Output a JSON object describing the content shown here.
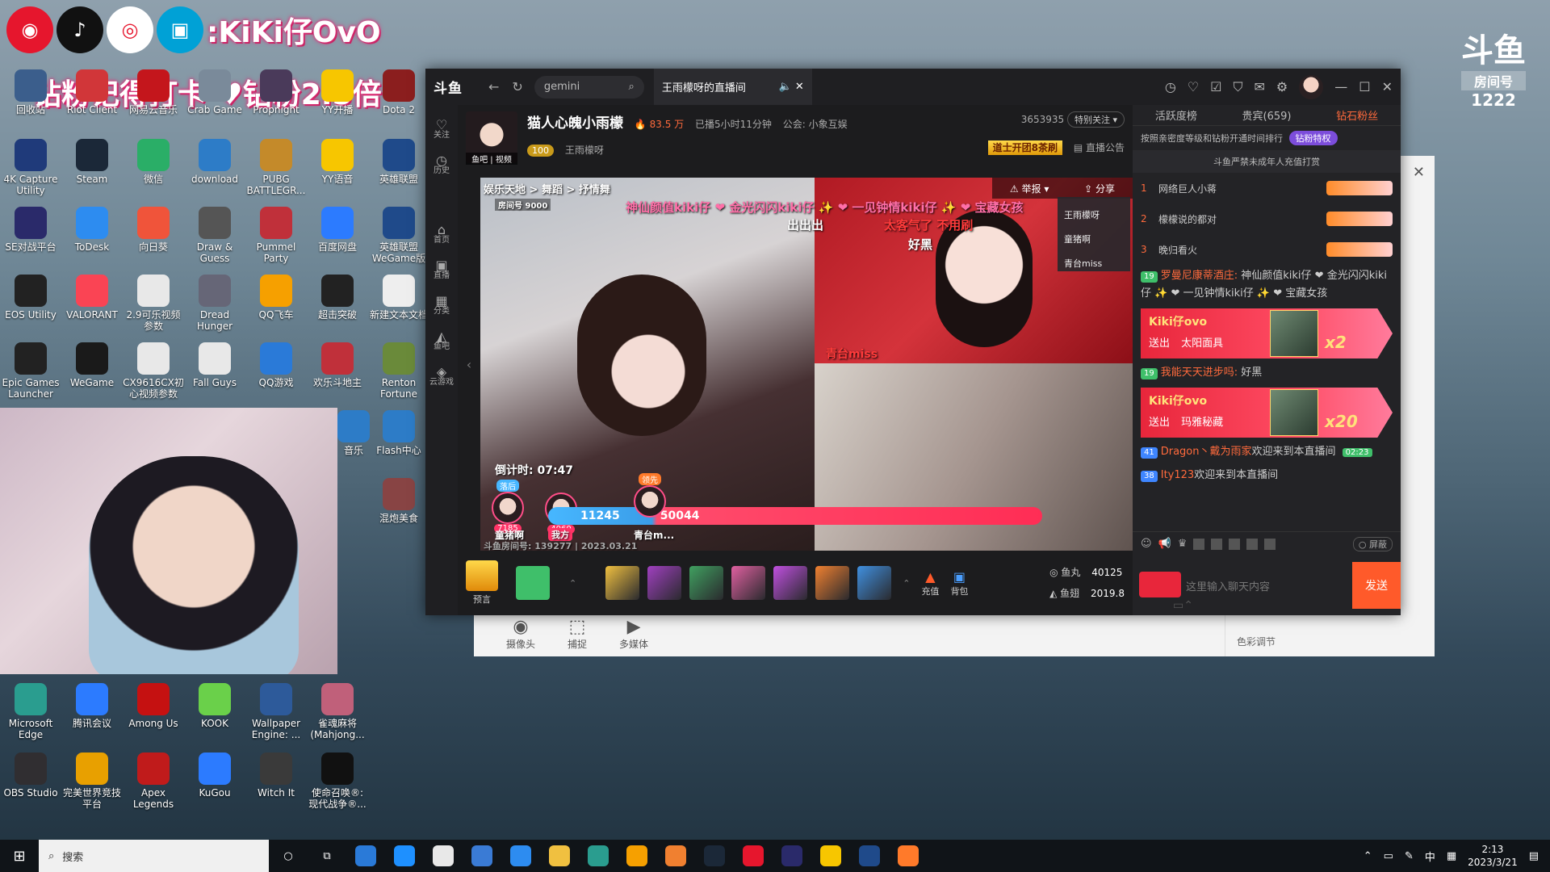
{
  "overlay": {
    "social_tag": ":KiKi仔OvO",
    "banner": "钻粉记得打卡 ♥钻粉2.5倍"
  },
  "brand": {
    "logo": "斗鱼",
    "room_label": "房间号",
    "room_no": "1222"
  },
  "desktop_icons": [
    {
      "label": "回收站",
      "color": "#3b5e8c"
    },
    {
      "label": "Riot Client",
      "color": "#d13639"
    },
    {
      "label": "网易云音乐",
      "color": "#c4161c"
    },
    {
      "label": "Crab Game",
      "color": "#7a8a9a"
    },
    {
      "label": "Propnight",
      "color": "#4a3a5a"
    },
    {
      "label": "YY开播",
      "color": "#f7c600"
    },
    {
      "label": "Dota 2",
      "color": "#8b1e1e"
    },
    {
      "label": "4K Capture Utility",
      "color": "#1f3a7a"
    },
    {
      "label": "Steam",
      "color": "#1b2838"
    },
    {
      "label": "微信",
      "color": "#2aae67"
    },
    {
      "label": "download",
      "color": "#2d7cc7"
    },
    {
      "label": "PUBG BATTLEGR...",
      "color": "#c48a2a"
    },
    {
      "label": "YY语音",
      "color": "#f7c600"
    },
    {
      "label": "英雄联盟",
      "color": "#1f4a8a"
    },
    {
      "label": "SE对战平台",
      "color": "#2a2a6a"
    },
    {
      "label": "ToDesk",
      "color": "#2d8cf0"
    },
    {
      "label": "向日葵",
      "color": "#f0543a"
    },
    {
      "label": "Draw & Guess",
      "color": "#555"
    },
    {
      "label": "Pummel Party",
      "color": "#c0303a"
    },
    {
      "label": "百度网盘",
      "color": "#2c7bff"
    },
    {
      "label": "英雄联盟WeGame版",
      "color": "#1f4a8a"
    },
    {
      "label": "EOS Utility",
      "color": "#222"
    },
    {
      "label": "VALORANT",
      "color": "#fa4454"
    },
    {
      "label": "2.9可乐视频参数",
      "color": "#e8e8e8"
    },
    {
      "label": "Dread Hunger",
      "color": "#667"
    },
    {
      "label": "QQ飞车",
      "color": "#f6a000"
    },
    {
      "label": "超击突破",
      "color": "#222"
    },
    {
      "label": "新建文本文档",
      "color": "#eee"
    },
    {
      "label": "Epic Games Launcher",
      "color": "#222"
    },
    {
      "label": "WeGame",
      "color": "#1a1a1a"
    },
    {
      "label": "CX9616CX初心视频参数",
      "color": "#e8e8e8"
    },
    {
      "label": "Fall Guys",
      "color": "#e8e8e8"
    },
    {
      "label": "QQ游戏",
      "color": "#2a7ad8"
    },
    {
      "label": "欢乐斗地主",
      "color": "#c0303a"
    },
    {
      "label": "Renton Fortune",
      "color": "#6a8a3a"
    },
    {
      "label": "音乐",
      "color": "#2d7cc7"
    },
    {
      "label": "Flash中心",
      "color": "#2d7cc7"
    },
    {
      "label": "混炮美食",
      "color": "#884444"
    },
    {
      "label": "Microsoft Edge",
      "color": "#2a9d8f"
    },
    {
      "label": "腾讯会议",
      "color": "#2c7bff"
    },
    {
      "label": "Among Us",
      "color": "#c51111"
    },
    {
      "label": "KOOK",
      "color": "#6ad04a"
    },
    {
      "label": "Wallpaper Engine: ...",
      "color": "#2d5a9a"
    },
    {
      "label": "雀魂麻将(Mahjong...",
      "color": "#c0607a"
    },
    {
      "label": "OBS Studio",
      "color": "#302e31"
    },
    {
      "label": "完美世界竞技平台",
      "color": "#e8a000"
    },
    {
      "label": "Apex Legends",
      "color": "#c01b1b"
    },
    {
      "label": "KuGou",
      "color": "#2c7bff"
    },
    {
      "label": "Witch It",
      "color": "#3a3a3a"
    },
    {
      "label": "使命召唤®:现代战争®...",
      "color": "#111"
    }
  ],
  "window": {
    "logo": "斗鱼",
    "search_placeholder": "gemini",
    "tab_title": "王雨檬呀的直播间"
  },
  "nav": [
    {
      "icon": "♡",
      "label": "关注"
    },
    {
      "icon": "◷",
      "label": "历史"
    },
    {
      "icon": "⌂",
      "label": "首页"
    },
    {
      "icon": "▣",
      "label": "直播"
    },
    {
      "icon": "▦",
      "label": "分类"
    },
    {
      "icon": "◭",
      "label": "鱼吧"
    },
    {
      "icon": "◈",
      "label": "云游戏"
    }
  ],
  "anchor": {
    "title": "猫人心魄小雨檬",
    "heat": "83.5 万",
    "duration": "已播5小时11分钟",
    "guild": "公会: 小象互娱",
    "followers": "3653935",
    "follow_btn": "特别关注",
    "level": "100",
    "name": "王雨檬呀",
    "pic_tag": "鱼吧 | 视频",
    "event_btn": "道士开团8茶刷",
    "notice_btn": "直播公告"
  },
  "video": {
    "breadcrumb": "娱乐天地 > 舞蹈 > 抒情舞",
    "room_badge": "房间号 9000",
    "report": "举报",
    "share": "分享",
    "popup_users": [
      "王雨檬呀",
      "童猪啊",
      "青台miss"
    ],
    "danmu": [
      "神仙颜值kiki仔 ❤ 金光闪闪kiki仔 ✨ ❤ 一见钟情kiki仔 ✨ ❤ 宝藏女孩",
      "出出出",
      "太客气了 不用刷",
      "好黑",
      "青台miss"
    ],
    "countdown": "倒计时: 07:47",
    "pk_left_label": "落后",
    "pk_lead_label": "领先",
    "pk_user1_score": "7185",
    "pk_user2_score": "4060",
    "pk_left_total": "11245",
    "pk_right_total": "50044",
    "pk_user1_name": "童猪啊",
    "pk_me": "我方",
    "pk_right_name": "青台m...",
    "room_info": "斗鱼房间号: 139277 | 2023.03.21"
  },
  "giftbar": {
    "trophy": "预言",
    "recharge": "充值",
    "backpack": "背包",
    "fish_ball_label": "鱼丸",
    "fish_ball": "40125",
    "fish_fin_label": "鱼翅",
    "fish_fin": "2019.8",
    "gift_colors": [
      "#f0c040",
      "#a040c0",
      "#40a060",
      "#e060a0",
      "#c050e0",
      "#f08030",
      "#4090e0"
    ]
  },
  "side": {
    "tabs": [
      "活跃度榜",
      "贵宾(659)",
      "钻石粉丝"
    ],
    "note": "按照亲密度等级和钻粉开通时间排行",
    "fans_btn": "钻粉特权",
    "warning": "斗鱼严禁未成年人充值打赏",
    "ranks": [
      {
        "no": "1",
        "name": "网络巨人小蒋"
      },
      {
        "no": "2",
        "name": "檬檬说的都对"
      },
      {
        "no": "3",
        "name": "晚归看火"
      }
    ],
    "chat1_lv": "19",
    "chat1_user": "罗曼尼康蒂酒庄:",
    "chat1_msg": "神仙颜值kiki仔 ❤ 金光闪闪kiki仔 ✨ ❤ 一见钟情kiki仔 ✨ ❤ 宝藏女孩",
    "banner1_who": "Kiki仔ovo",
    "banner1_action": "送出",
    "banner1_gift": "太阳面具",
    "banner1_mul": "x2",
    "chat2_lv": "19",
    "chat2_user": "我能天天进步吗:",
    "chat2_msg": "好黑",
    "banner2_who": "Kiki仔ovo",
    "banner2_action": "送出",
    "banner2_gift": "玛雅秘藏",
    "banner2_mul": "x20",
    "chat3_lv": "41",
    "chat3_user": "Dragon丶戴为雨家",
    "chat3_msg": "欢迎来到本直播间",
    "chat3_timer": "02:23",
    "chat4_lv": "38",
    "chat4_user": "Ity123",
    "chat4_msg": "欢迎来到本直播间",
    "shield_label": "屏蔽",
    "input_placeholder": "这里输入聊天内容",
    "send": "发送"
  },
  "obs": {
    "camera": "摄像头",
    "capture": "捕捉",
    "media": "多媒体",
    "color_adjust": "色彩调节"
  },
  "taskbar": {
    "search": "搜索",
    "time": "2:13",
    "date": "2023/3/21",
    "ime": "中"
  }
}
